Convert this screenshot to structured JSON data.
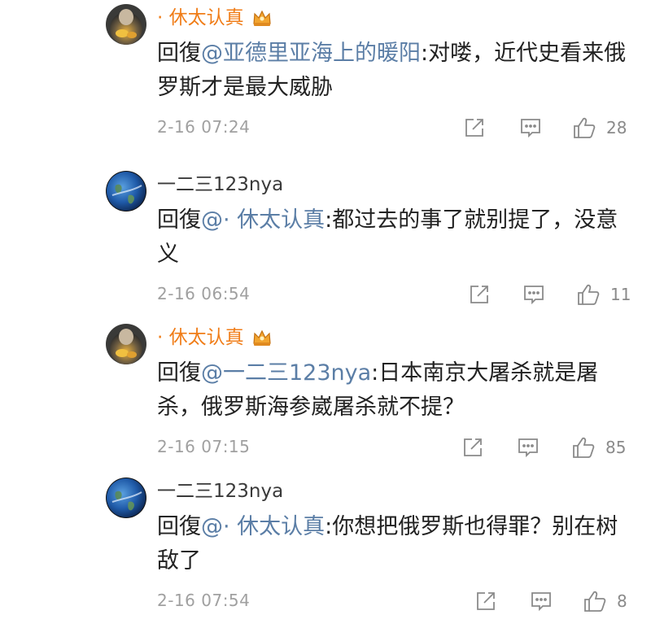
{
  "comments": [
    {
      "user": "· 休太认真",
      "vip": true,
      "reply_prefix": "回復",
      "mention": "@亚德里亚海上的暖阳",
      "text": ":对喽，近代史看来俄罗斯才是最大威胁",
      "time": "2-16 07:24",
      "likes": "28"
    },
    {
      "user": "一二三123nya",
      "vip": false,
      "reply_prefix": "回復",
      "mention": "@· 休太认真",
      "text": ":都过去的事了就别提了，没意义",
      "time": "2-16 06:54",
      "likes": "11"
    },
    {
      "user": "· 休太认真",
      "vip": true,
      "reply_prefix": "回復",
      "mention": "@一二三123nya",
      "text": ":日本南京大屠杀就是屠杀，俄罗斯海参崴屠杀就不提？",
      "time": "2-16 07:15",
      "likes": "85"
    },
    {
      "user": "一二三123nya",
      "vip": false,
      "reply_prefix": "回復",
      "mention": "@· 休太认真",
      "text": ":你想把俄罗斯也得罪？别在树敌了",
      "time": "2-16 07:54",
      "likes": "8"
    }
  ],
  "colors": {
    "vip_name": "#f07d18",
    "normal_name": "#3a3a3a",
    "mention": "#5b7ea6",
    "meta": "#a0a0a0"
  },
  "icons": [
    "share-icon",
    "comment-icon",
    "like-icon",
    "crown-badge-icon"
  ]
}
